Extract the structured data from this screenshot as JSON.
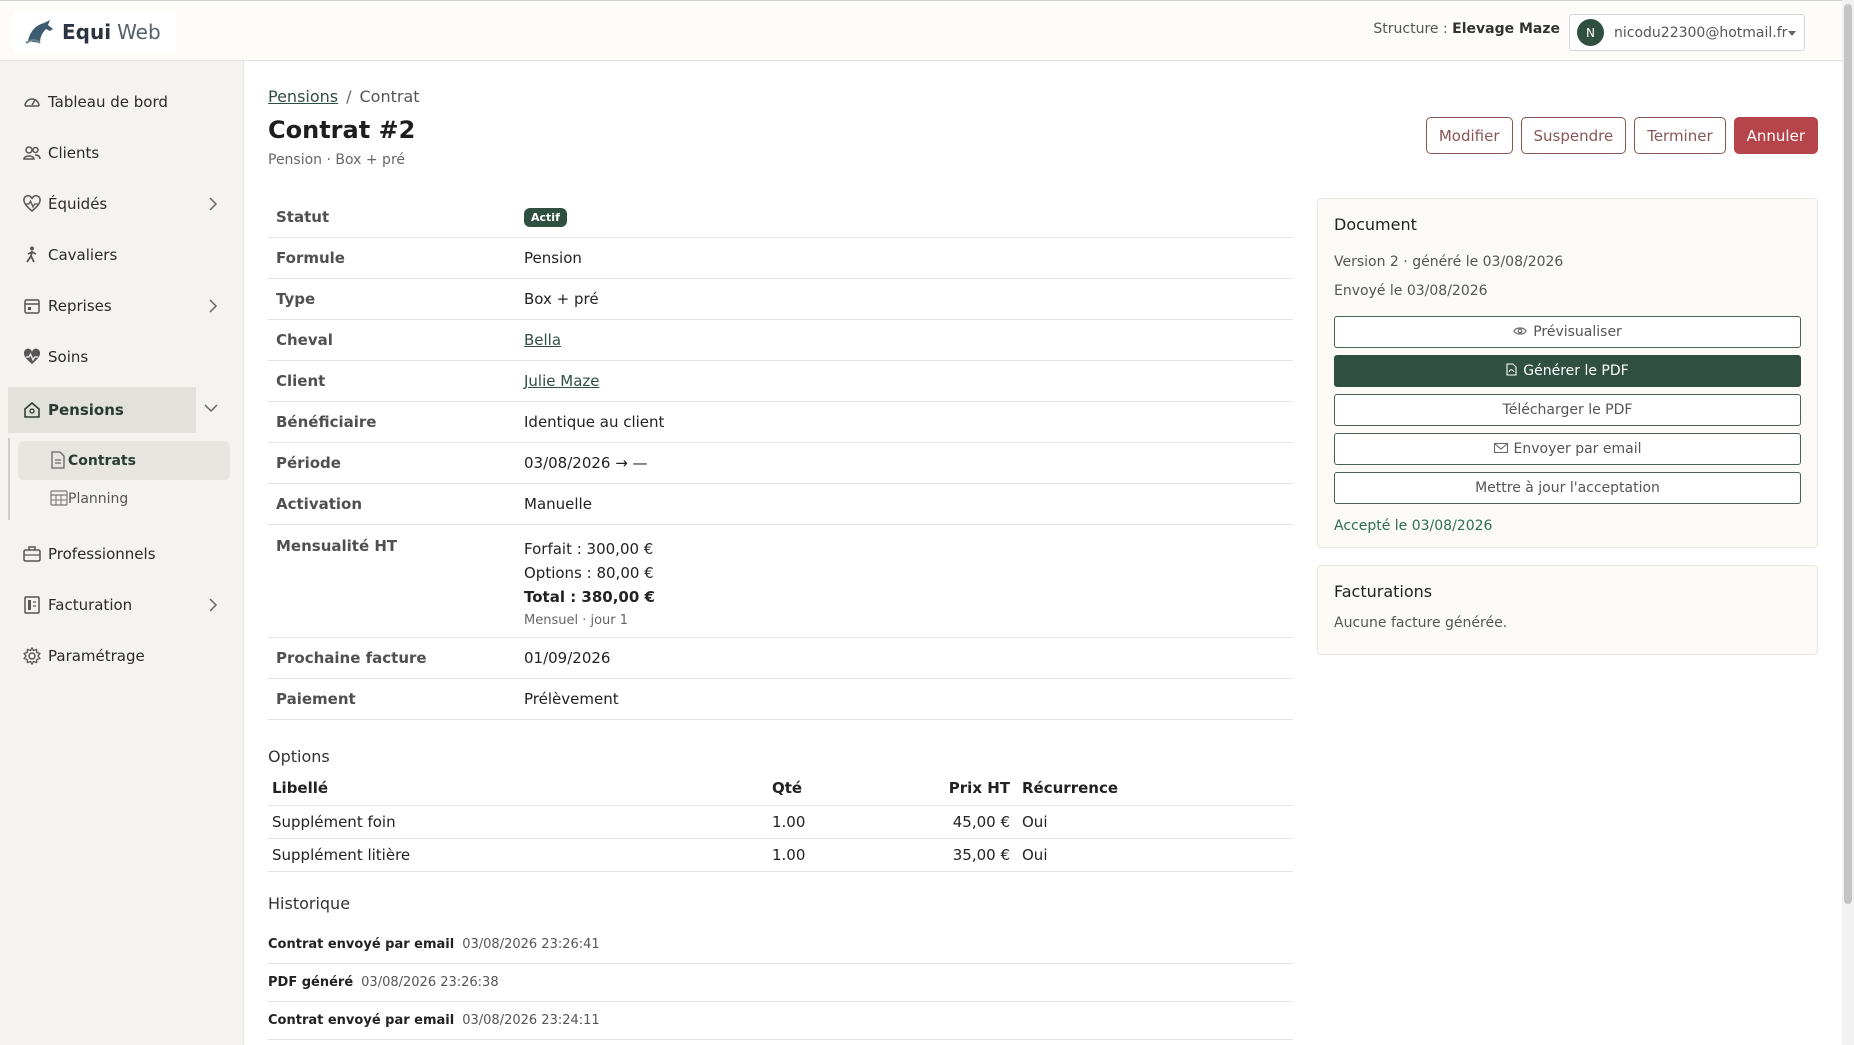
{
  "app": {
    "name_part1": "Equi",
    "name_part2": "Web"
  },
  "header": {
    "structure_label": "Structure : ",
    "structure_value": "Elevage Maze",
    "user_initial": "N",
    "user_email": "nicodu22300@hotmail.fr"
  },
  "sidebar": {
    "items": [
      {
        "label": "Tableau de bord",
        "icon": "dashboard-icon"
      },
      {
        "label": "Clients",
        "icon": "users-icon"
      },
      {
        "label": "Équidés",
        "icon": "heart-pulse-icon"
      },
      {
        "label": "Cavaliers",
        "icon": "rider-icon"
      },
      {
        "label": "Reprises",
        "icon": "calendar-icon"
      },
      {
        "label": "Soins",
        "icon": "heart-icon"
      },
      {
        "label": "Pensions",
        "icon": "home-icon"
      },
      {
        "label": "Professionnels",
        "icon": "briefcase-icon"
      },
      {
        "label": "Facturation",
        "icon": "invoice-icon"
      },
      {
        "label": "Paramétrage",
        "icon": "gear-icon"
      }
    ],
    "sub_items": [
      {
        "label": "Contrats"
      },
      {
        "label": "Planning"
      }
    ]
  },
  "breadcrumb": {
    "parent": "Pensions",
    "separator": "/",
    "current": "Contrat"
  },
  "page": {
    "title": "Contrat #2",
    "subtitle": "Pension · Box + pré"
  },
  "actions": {
    "edit": "Modifier",
    "suspend": "Suspendre",
    "finish": "Terminer",
    "cancel": "Annuler"
  },
  "details": {
    "status": {
      "label": "Statut",
      "value": "Actif"
    },
    "formula": {
      "label": "Formule",
      "value": "Pension"
    },
    "type": {
      "label": "Type",
      "value": "Box + pré"
    },
    "horse": {
      "label": "Cheval",
      "value": "Bella"
    },
    "client": {
      "label": "Client",
      "value": "Julie Maze"
    },
    "beneficiary": {
      "label": "Bénéficiaire",
      "value": "Identique au client"
    },
    "period": {
      "label": "Période",
      "value": "03/08/2026 → —"
    },
    "activation": {
      "label": "Activation",
      "value": "Manuelle"
    },
    "monthly": {
      "label": "Mensualité HT",
      "forfait": "Forfait : 300,00 €",
      "options": "Options : 80,00 €",
      "total": "Total : 380,00 €",
      "note": "Mensuel · jour 1"
    },
    "next_invoice": {
      "label": "Prochaine facture",
      "value": "01/09/2026"
    },
    "payment": {
      "label": "Paiement",
      "value": "Prélèvement"
    }
  },
  "options": {
    "title": "Options",
    "headers": {
      "label": "Libellé",
      "qty": "Qté",
      "price": "Prix HT",
      "recurrence": "Récurrence"
    },
    "rows": [
      {
        "label": "Supplément foin",
        "qty": "1.00",
        "price": "45,00 €",
        "recurrence": "Oui"
      },
      {
        "label": "Supplément litière",
        "qty": "1.00",
        "price": "35,00 €",
        "recurrence": "Oui"
      }
    ]
  },
  "history": {
    "title": "Historique",
    "rows": [
      {
        "event": "Contrat envoyé par email",
        "time": "03/08/2026 23:26:41"
      },
      {
        "event": "PDF généré",
        "time": "03/08/2026 23:26:38"
      },
      {
        "event": "Contrat envoyé par email",
        "time": "03/08/2026 23:24:11"
      }
    ]
  },
  "document": {
    "title": "Document",
    "version": "Version 2 · généré le 03/08/2026",
    "sent": "Envoyé le 03/08/2026",
    "preview": "Prévisualiser",
    "generate": "Générer le PDF",
    "download": "Télécharger le PDF",
    "email": "Envoyer par email",
    "update_acceptance": "Mettre à jour l'acceptation",
    "accepted": "Accepté le 03/08/2026"
  },
  "invoices": {
    "title": "Facturations",
    "empty": "Aucune facture générée."
  },
  "colors": {
    "primary": "#2f5040",
    "danger": "#b5444b",
    "outline": "#8a5555"
  }
}
